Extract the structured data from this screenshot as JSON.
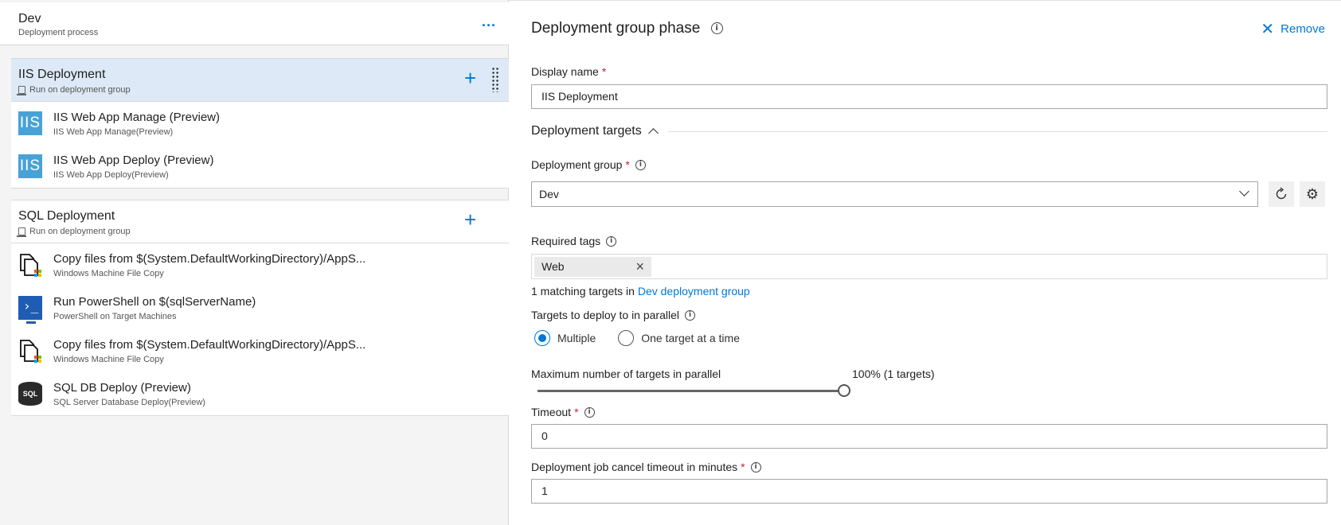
{
  "left": {
    "header": {
      "title": "Dev",
      "subtitle": "Deployment process",
      "more": "..."
    },
    "phases": [
      {
        "title": "IIS Deployment",
        "subtitle": "Run on deployment group",
        "tasks": [
          {
            "title": "IIS Web App Manage (Preview)",
            "subtitle": "IIS Web App Manage(Preview)",
            "icon_text": "IIS"
          },
          {
            "title": "IIS Web App Deploy (Preview)",
            "subtitle": "IIS Web App Deploy(Preview)",
            "icon_text": "IIS"
          }
        ]
      },
      {
        "title": "SQL Deployment",
        "subtitle": "Run on deployment group",
        "tasks": [
          {
            "title": "Copy files from $(System.DefaultWorkingDirectory)/AppS...",
            "subtitle": "Windows Machine File Copy"
          },
          {
            "title": "Run PowerShell on $(sqlServerName)",
            "subtitle": "PowerShell on Target Machines"
          },
          {
            "title": "Copy files from $(System.DefaultWorkingDirectory)/AppS...",
            "subtitle": "Windows Machine File Copy"
          },
          {
            "title": "SQL DB Deploy (Preview)",
            "subtitle": "SQL Server Database Deploy(Preview)",
            "icon_text": "SQL"
          }
        ]
      }
    ]
  },
  "right": {
    "title": "Deployment group phase",
    "remove_label": "Remove",
    "display_name": {
      "label": "Display name",
      "required": "*",
      "value": "IIS Deployment"
    },
    "section_title": "Deployment targets",
    "deployment_group": {
      "label": "Deployment group",
      "required": "*",
      "value": "Dev"
    },
    "required_tags": {
      "label": "Required tags",
      "tags": [
        "Web"
      ]
    },
    "matching": {
      "prefix": "1 matching targets in ",
      "link": "Dev deployment group"
    },
    "parallel": {
      "label": "Targets to deploy to in parallel",
      "options": [
        "Multiple",
        "One target at a time"
      ],
      "selected": "Multiple"
    },
    "max_targets": {
      "label": "Maximum number of targets in parallel",
      "value_text": "100% (1 targets)",
      "fraction": 1.0
    },
    "timeout": {
      "label": "Timeout",
      "required": "*",
      "value": "0"
    },
    "cancel_timeout": {
      "label": "Deployment job cancel timeout in minutes",
      "required": "*",
      "value": "1"
    }
  },
  "colors": {
    "accent": "#0078d4",
    "selected_bg": "#dde9f6",
    "required": "#c4262e"
  }
}
